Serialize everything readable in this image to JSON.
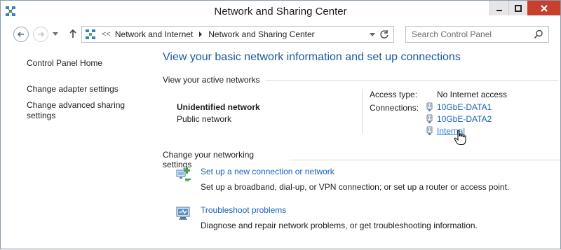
{
  "window": {
    "title": "Network and Sharing Center"
  },
  "address_bar": {
    "overflow": "<<",
    "crumbs": [
      "Network and Internet",
      "Network and Sharing Center"
    ]
  },
  "search": {
    "placeholder": "Search Control Panel"
  },
  "sidebar": {
    "links": [
      "Control Panel Home",
      "Change adapter settings",
      "Change advanced sharing settings"
    ]
  },
  "main": {
    "title": "View your basic network information and set up connections",
    "active_networks_heading": "View your active networks",
    "network": {
      "name": "Unidentified network",
      "category": "Public network",
      "access_type_label": "Access type:",
      "access_type_value": "No Internet access",
      "connections_label": "Connections:",
      "connections": [
        "10GbE-DATA1",
        "10GbE-DATA2",
        "Internal"
      ]
    },
    "change_heading": "Change your networking settings",
    "tasks": [
      {
        "link": "Set up a new connection or network",
        "desc": "Set up a broadband, dial-up, or VPN connection; or set up a router or access point.",
        "icon": "new-connection-icon"
      },
      {
        "link": "Troubleshoot problems",
        "desc": "Diagnose and repair network problems, or get troubleshooting information.",
        "icon": "troubleshoot-icon"
      }
    ]
  },
  "colors": {
    "link": "#1a62b8",
    "title_blue": "#1a5a9a",
    "close_button": "#c7402e"
  }
}
